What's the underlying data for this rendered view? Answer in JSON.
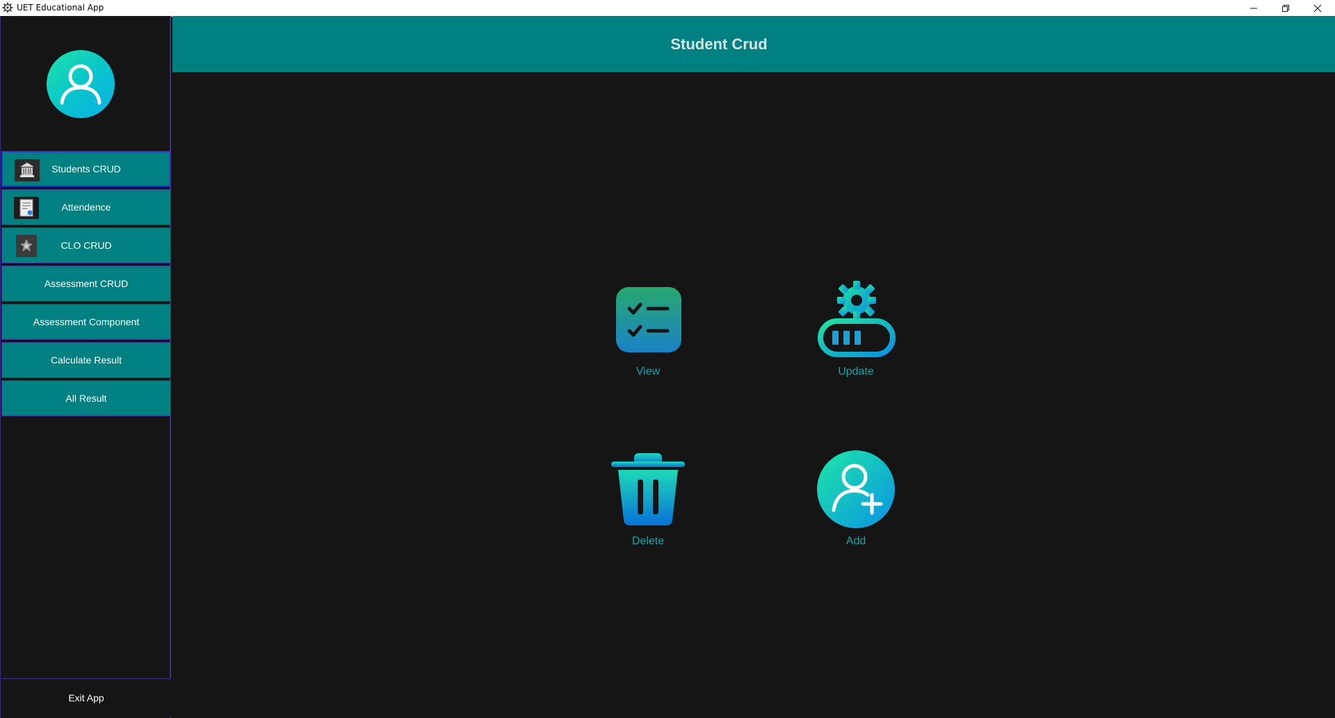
{
  "window": {
    "title": "UET Educational App"
  },
  "header": {
    "title": "Student Crud"
  },
  "sidebar": {
    "items": [
      {
        "label": "Students CRUD",
        "icon": "students-icon",
        "active": true
      },
      {
        "label": "Attendence",
        "icon": "attendance-icon"
      },
      {
        "label": "CLO CRUD",
        "icon": "clo-icon"
      },
      {
        "label": "Assessment CRUD"
      },
      {
        "label": "Assessment Component"
      },
      {
        "label": "Calculate Result"
      },
      {
        "label": "All Result"
      }
    ],
    "exit_label": "Exit App"
  },
  "actions": {
    "view": {
      "label": "View",
      "icon": "checklist-icon"
    },
    "update": {
      "label": "Update",
      "icon": "gear-progress-icon"
    },
    "delete": {
      "label": "Delete",
      "icon": "trash-icon"
    },
    "add": {
      "label": "Add",
      "icon": "add-user-icon"
    }
  },
  "colors": {
    "accent": "#008080",
    "background": "#151515",
    "nav_border": "#3b2d8f",
    "action_label": "#1aa3a8",
    "gradient_start": "#1ee3a8",
    "gradient_end": "#0a8fe0"
  }
}
